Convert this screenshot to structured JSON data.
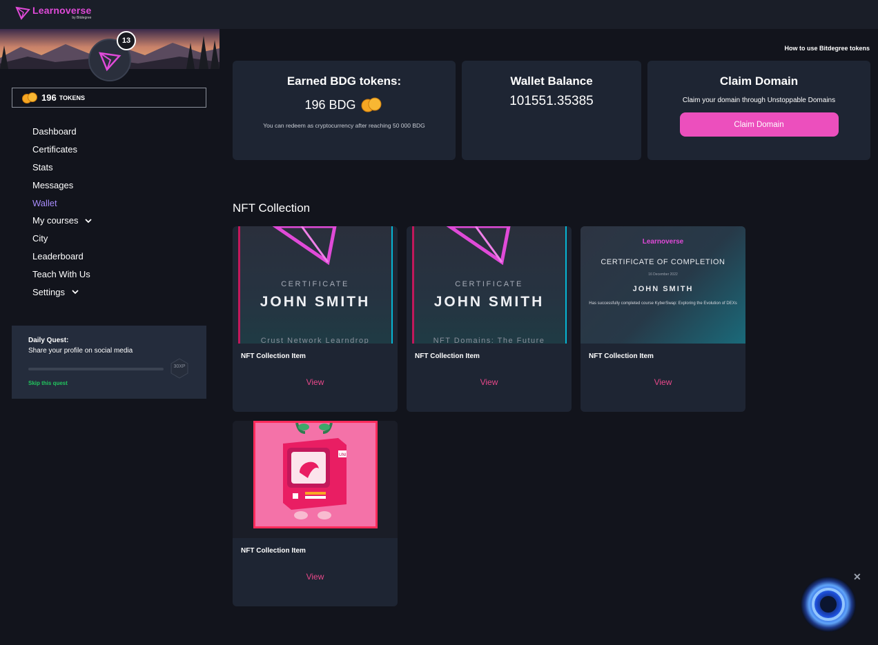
{
  "brand": {
    "name": "Learnoverse",
    "sub": "by Bitdegree",
    "accent": "#e04ad8"
  },
  "profile": {
    "level": "13",
    "tokens_amount": "196",
    "tokens_label": "TOKENS"
  },
  "nav": {
    "items": [
      {
        "label": "Dashboard"
      },
      {
        "label": "Certificates"
      },
      {
        "label": "Stats"
      },
      {
        "label": "Messages"
      },
      {
        "label": "Wallet",
        "active": true
      },
      {
        "label": "My courses"
      },
      {
        "label": "City"
      },
      {
        "label": "Leaderboard"
      },
      {
        "label": "Teach With Us"
      },
      {
        "label": "Settings"
      }
    ]
  },
  "quest": {
    "title": "Daily Quest:",
    "description": "Share your profile on social media",
    "xp": "30XP",
    "skip_label": "Skip this quest",
    "progress": 0
  },
  "header": {
    "help_link": "How to use Bitdegree tokens"
  },
  "cards": {
    "earned": {
      "title": "Earned BDG tokens:",
      "amount": "196 BDG",
      "note": "You can redeem as cryptocurrency after reaching 50 000 BDG"
    },
    "wallet": {
      "title": "Wallet Balance",
      "balance": "101551.35385"
    },
    "claim": {
      "title": "Claim Domain",
      "description": "Claim your domain through Unstoppable Domains",
      "button": "Claim Domain"
    }
  },
  "nft_section": {
    "title": "NFT Collection",
    "items": [
      {
        "name": "NFT Collection Item",
        "view": "View",
        "cert_label": "CERTIFICATE",
        "cert_name": "JOHN SMITH",
        "cert_course": "Crust Network Learndrop"
      },
      {
        "name": "NFT Collection Item",
        "view": "View",
        "cert_label": "CERTIFICATE",
        "cert_name": "JOHN SMITH",
        "cert_course": "NFT Domains: The Future"
      },
      {
        "name": "NFT Collection Item",
        "view": "View",
        "cert_logo": "Learnoverse",
        "cert_title": "CERTIFICATE OF COMPLETION",
        "cert_date": "16 December 2022",
        "cert_name": "JOHN SMITH",
        "cert_desc": "Has successfully completed course KyberSwap: Exploring the Evolution of DEXs"
      },
      {
        "name": "NFT Collection Item",
        "view": "View",
        "art_tag": "UNI"
      }
    ]
  }
}
